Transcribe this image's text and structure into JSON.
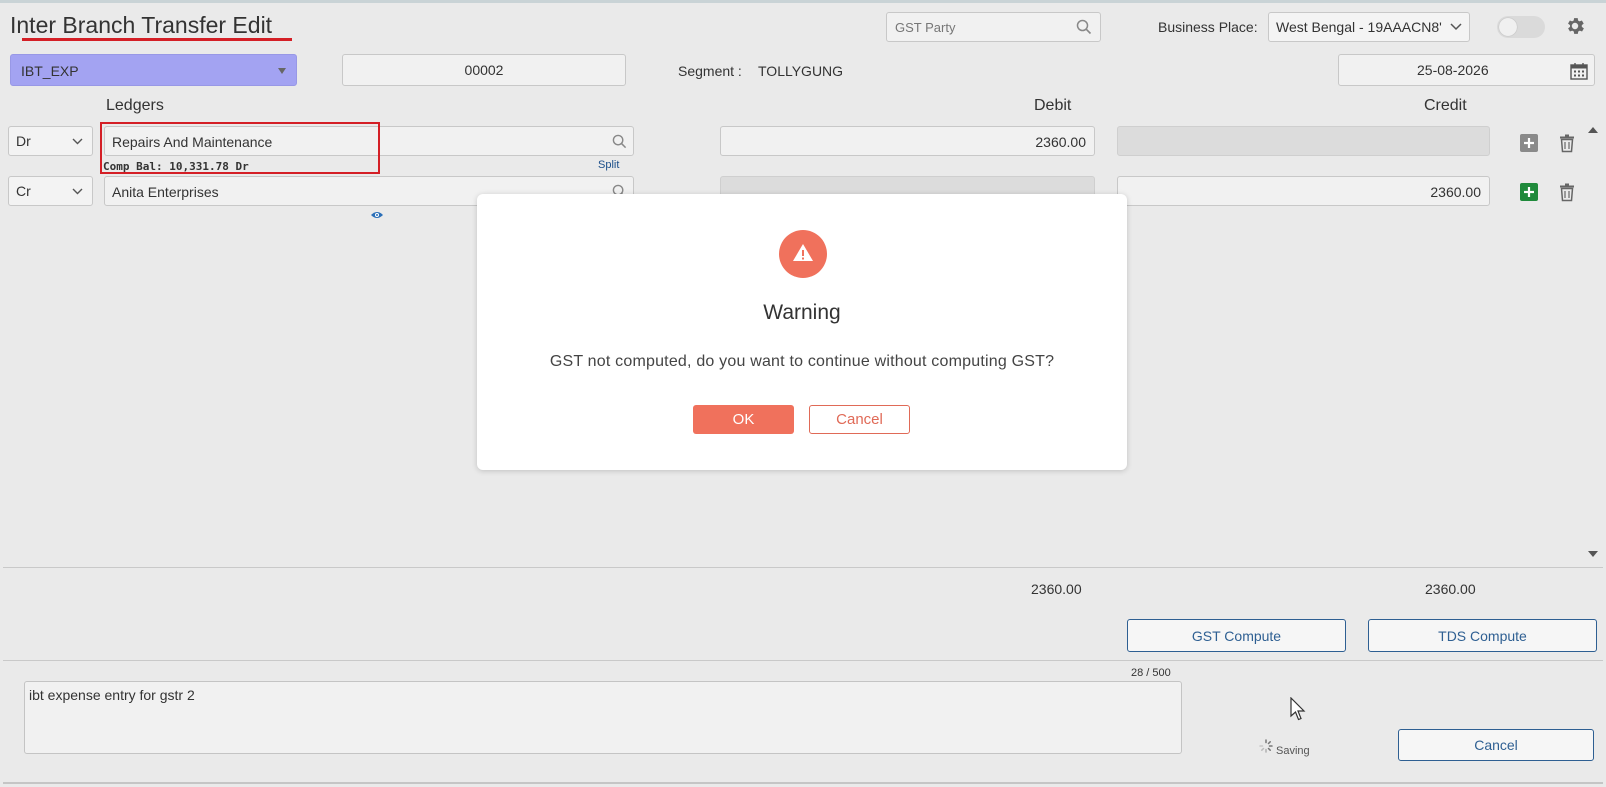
{
  "page": {
    "title": "Inter Branch Transfer Edit"
  },
  "header": {
    "gst_party_placeholder": "GST Party",
    "business_place_label": "Business Place:",
    "business_place_value": "West Bengal - 19AAACN8'"
  },
  "voucher": {
    "type": "IBT_EXP",
    "number": "00002",
    "segment_label": "Segment :",
    "segment_value": "TOLLYGUNG",
    "date": "25-08-2026"
  },
  "grid": {
    "headers": {
      "ledgers": "Ledgers",
      "debit": "Debit",
      "credit": "Credit"
    },
    "rows": [
      {
        "drcr": "Dr",
        "ledger": "Repairs And Maintenance",
        "comp_bal": "Comp Bal: 10,331.78 Dr",
        "split": "Split",
        "debit": "2360.00",
        "credit": ""
      },
      {
        "drcr": "Cr",
        "ledger": "Anita Enterprises",
        "debit": "",
        "credit": "2360.00"
      }
    ],
    "totals": {
      "debit": "2360.00",
      "credit": "2360.00"
    }
  },
  "actions": {
    "gst_compute": "GST Compute",
    "tds_compute": "TDS Compute",
    "cancel": "Cancel"
  },
  "narration": {
    "char_count": "28 / 500",
    "text": "ibt expense entry for gstr 2"
  },
  "status": {
    "saving": "Saving"
  },
  "dialog": {
    "title": "Warning",
    "message": "GST not computed, do you want to continue without computing GST?",
    "ok": "OK",
    "cancel": "Cancel"
  },
  "colors": {
    "accent_red": "#d41f26",
    "warning": "#f0715c",
    "primary_blue": "#2e5f92",
    "voucher_type_bg": "#a3a3f2",
    "add_green": "#1f8a3b"
  },
  "icons": [
    "search-icon",
    "chevron-down-icon",
    "gear-icon",
    "calendar-icon",
    "plus-icon",
    "trash-icon",
    "eye-icon",
    "warning-icon",
    "spinner-icon",
    "cursor-icon"
  ]
}
